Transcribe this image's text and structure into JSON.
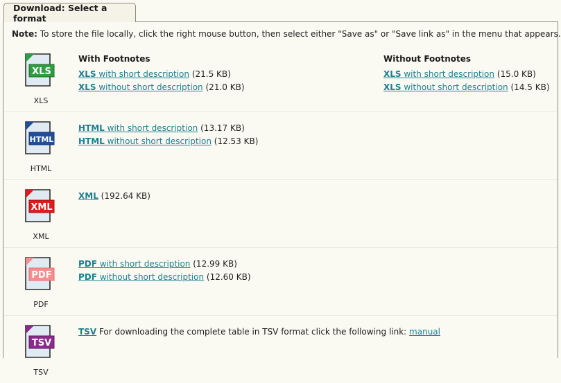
{
  "window": {
    "tab_label": "Download: Select a format"
  },
  "note": {
    "label": "Note:",
    "text": " To store the file locally, click the right mouse button, then select either \"Save as\" or \"Save link as\" in the menu that appears."
  },
  "columns": {
    "with_footnotes": "With Footnotes",
    "without_footnotes": "Without Footnotes"
  },
  "formats": {
    "xls": {
      "icon_name": "xls-file-icon",
      "badge": "XLS",
      "caption": "XLS",
      "badge_color": "#2f9e41",
      "with_footnotes": [
        {
          "fmt": "XLS",
          "text": " with short description",
          "size": "(21.5 KB)"
        },
        {
          "fmt": "XLS",
          "text": " without short description",
          "size": "(21.0 KB)"
        }
      ],
      "without_footnotes": [
        {
          "fmt": "XLS",
          "text": " with short description",
          "size": "(15.0 KB)"
        },
        {
          "fmt": "XLS",
          "text": " without short description",
          "size": "(14.5 KB)"
        }
      ]
    },
    "html": {
      "icon_name": "html-file-icon",
      "badge": "HTML",
      "caption": "HTML",
      "badge_color": "#1f4e9c",
      "links": [
        {
          "fmt": "HTML",
          "text": " with short description",
          "size": "(13.17 KB)"
        },
        {
          "fmt": "HTML",
          "text": " without short description",
          "size": "(12.53 KB)"
        }
      ]
    },
    "xml": {
      "icon_name": "xml-file-icon",
      "badge": "XML",
      "caption": "XML",
      "badge_color": "#e01b1b",
      "links": [
        {
          "fmt": "XML",
          "text": "",
          "size": "(192.64 KB)"
        }
      ]
    },
    "pdf": {
      "icon_name": "pdf-file-icon",
      "badge": "PDF",
      "caption": "PDF",
      "badge_color": "#f58f8f",
      "links": [
        {
          "fmt": "PDF",
          "text": " with short description",
          "size": "(12.99 KB)"
        },
        {
          "fmt": "PDF",
          "text": " without short description",
          "size": "(12.60 KB)"
        }
      ]
    },
    "tsv": {
      "icon_name": "tsv-file-icon",
      "badge": "TSV",
      "caption": "TSV",
      "badge_color": "#8e2a8e",
      "link_label": "TSV",
      "description": " For downloading the complete table in TSV format click the following link: ",
      "manual_link": "manual"
    }
  },
  "colors": {
    "page_background": "#fbfaf2",
    "tab_background": "#f5f2e7",
    "border": "#8d8a7a",
    "divider": "#eceadd",
    "link": "#1a7f91"
  }
}
